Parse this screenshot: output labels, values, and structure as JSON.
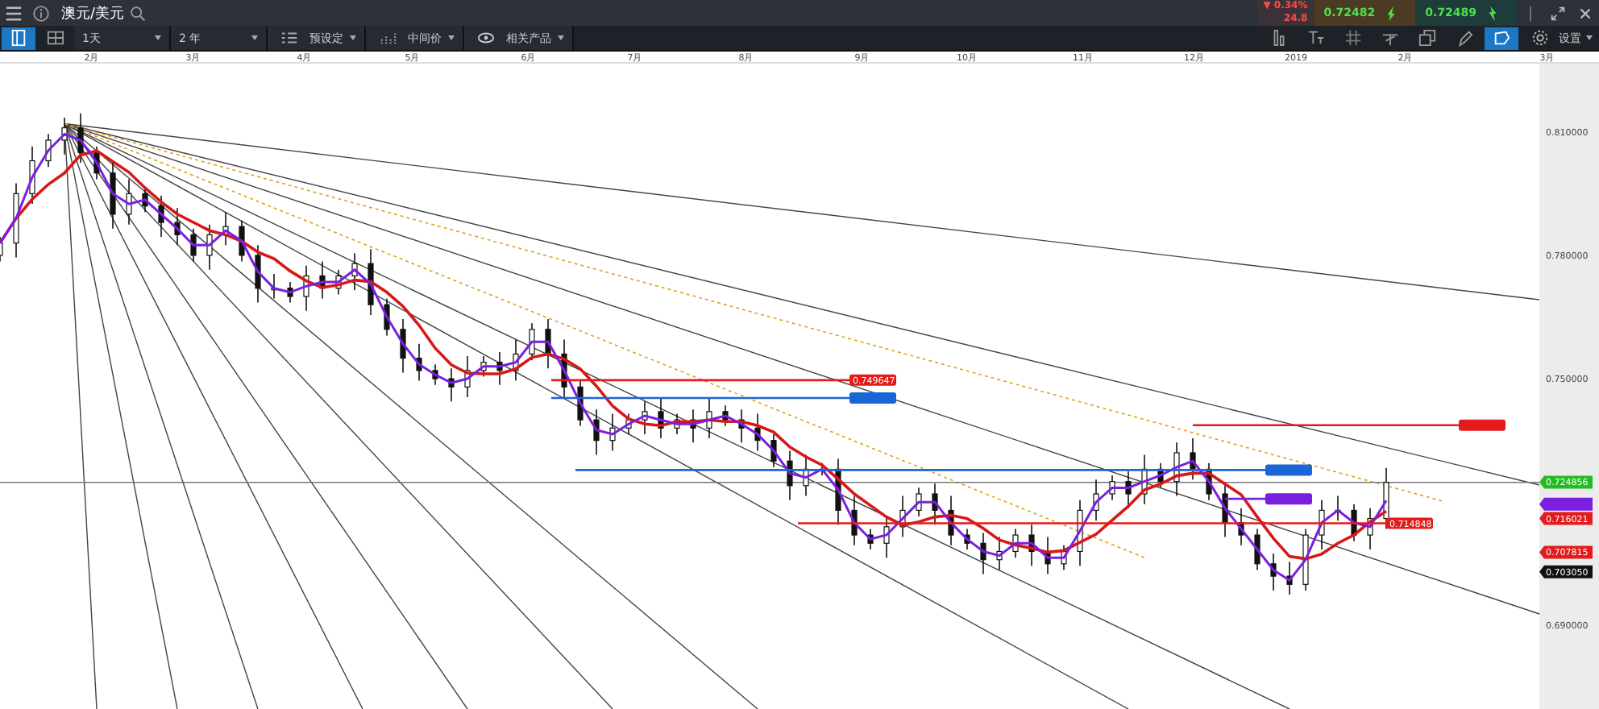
{
  "header": {
    "title": "澳元/美元",
    "change": "▼ 0.34%",
    "change_points": "24.8",
    "sell_price": "0.72482",
    "buy_price": "0.72489"
  },
  "toolbar": {
    "dropdowns": [
      {
        "label": "1天",
        "kind": "plain"
      },
      {
        "label": "2 年",
        "kind": "plain"
      },
      {
        "label": "预设定",
        "kind": "preset"
      },
      {
        "label": "中间价",
        "kind": "price"
      },
      {
        "label": "相关产品",
        "kind": "related"
      }
    ],
    "settings_label": "设置"
  },
  "chart": {
    "month_labels": [
      "2月",
      "3月",
      "4月",
      "5月",
      "6月",
      "7月",
      "8月",
      "9月",
      "10月",
      "11月",
      "12月",
      "2019",
      "2月",
      "3月"
    ],
    "price_labels": [
      "0.810000",
      "0.780000",
      "0.750000",
      "0.690000"
    ],
    "levels": [
      {
        "label": "0.749647",
        "color": "#e31b1b"
      },
      {
        "color": "#1a66d6"
      },
      {
        "color": "#1a66d6"
      },
      {
        "color": "#7a1fe0"
      },
      {
        "color": "#e31b1b"
      },
      {
        "label": "0.714848",
        "color": "#e31b1b"
      }
    ],
    "axis_tags": [
      {
        "label": "0.724856",
        "color": "#22bb22"
      },
      {
        "color": "#7a1fe0"
      },
      {
        "label": "0.716021",
        "color": "#e31b1b"
      },
      {
        "label": "0.707815",
        "color": "#e31b1b"
      },
      {
        "label": "0.703050",
        "color": "#111111"
      }
    ]
  }
}
